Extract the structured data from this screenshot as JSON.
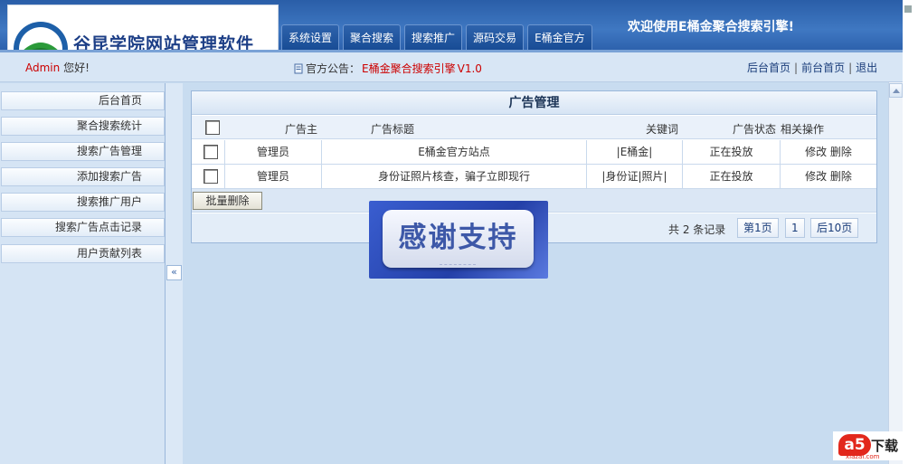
{
  "header": {
    "logo_text": "谷昆学院网站管理软件",
    "nav_tabs": [
      "系统设置",
      "聚合搜索",
      "搜索推广",
      "源码交易",
      "E桶金官方"
    ],
    "welcome": "欢迎使用E桶金聚合搜索引擎!"
  },
  "infobar": {
    "username": "Admin",
    "greeting": "您好!",
    "notice_label": "官方公告：",
    "notice_title": "E桶金聚合搜索引擎",
    "notice_version": " V1.0",
    "links": [
      "后台首页",
      "前台首页",
      "退出"
    ],
    "separator": "|"
  },
  "sidebar": {
    "items": [
      "后台首页",
      "聚合搜索统计",
      "搜索广告管理",
      "添加搜索广告",
      "搜索推广用户",
      "搜索广告点击记录",
      "用户贡献列表"
    ],
    "collapse_label": "«"
  },
  "panel": {
    "title": "广告管理",
    "columns": [
      "广告主",
      "广告标题",
      "关键词",
      "广告状态",
      "相关操作"
    ],
    "rows": [
      {
        "advertiser": "管理员",
        "title": "E桶金官方站点",
        "keywords": "|E桶金|",
        "status": "正在投放",
        "edit": "修改",
        "delete": "删除"
      },
      {
        "advertiser": "管理员",
        "title": "身份证照片核查，骗子立即现行",
        "keywords": "|身份证|照片|",
        "status": "正在投放",
        "edit": "修改",
        "delete": "删除"
      }
    ],
    "bulk_delete": "批量删除",
    "pager": {
      "total": "共  2 条记录",
      "first": "第1页",
      "current": "1",
      "next": "后10页"
    }
  },
  "banner": {
    "text": "感谢支持"
  },
  "watermark": {
    "badge": "a5",
    "text": "下载",
    "sub": "xiazai.com"
  },
  "colors": {
    "header_blue": "#2a5ea8",
    "accent_red": "#cc0000",
    "banner_blue": "#2440a8"
  }
}
